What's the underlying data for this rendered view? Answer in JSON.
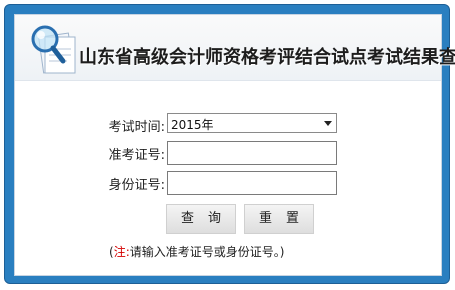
{
  "header": {
    "title": "山东省高级会计师资格考评结合试点考试结果查询",
    "logo_icon": "magnifier-document-icon"
  },
  "form": {
    "exam_time": {
      "label": "考试时间:",
      "selected": "2015年",
      "icon": "chevron-down-icon"
    },
    "admission_no": {
      "label": "准考证号:",
      "value": ""
    },
    "id_no": {
      "label": "身份证号:",
      "value": ""
    }
  },
  "buttons": {
    "query": "查询",
    "reset": "重置"
  },
  "note": {
    "open": "(",
    "prefix": "注:",
    "text": "请输入准考证号或身份证号。)"
  },
  "colors": {
    "frame": "#2a7fc0",
    "note_red": "#d40000"
  }
}
